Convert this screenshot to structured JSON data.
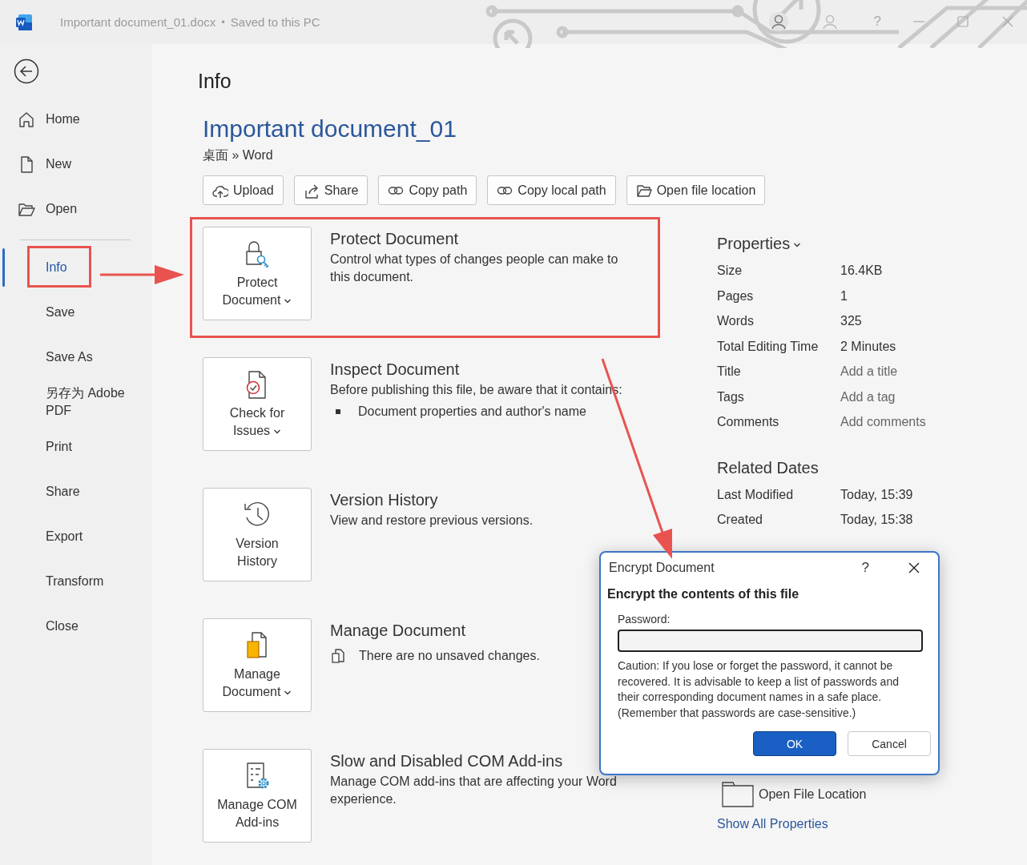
{
  "window": {
    "title": "Important document_01.docx",
    "separator": "•",
    "save_state": "Saved to this PC",
    "help": "?"
  },
  "nav_top": [
    {
      "kind": "home",
      "label": "Home",
      "selected": false,
      "highlighted": false
    },
    {
      "kind": "new",
      "label": "New",
      "selected": false,
      "highlighted": false
    },
    {
      "kind": "open",
      "label": "Open",
      "selected": false,
      "highlighted": false
    }
  ],
  "nav_bottom": [
    {
      "label": "Info",
      "selected": true,
      "highlighted": true
    },
    {
      "label": "Save",
      "selected": false,
      "highlighted": false
    },
    {
      "label": "Save As",
      "selected": false,
      "highlighted": false
    },
    {
      "label": "另存为 Adobe PDF",
      "selected": false,
      "highlighted": false
    },
    {
      "label": "Print",
      "selected": false,
      "highlighted": false
    },
    {
      "label": "Share",
      "selected": false,
      "highlighted": false
    },
    {
      "label": "Export",
      "selected": false,
      "highlighted": false
    },
    {
      "label": "Transform",
      "selected": false,
      "highlighted": false
    },
    {
      "label": "Close",
      "selected": false,
      "highlighted": false
    }
  ],
  "page_title": "Info",
  "document": {
    "name": "Important document_01",
    "path": "桌面 » Word"
  },
  "actions": [
    {
      "kind": "upload",
      "label": "Upload"
    },
    {
      "kind": "share",
      "label": "Share"
    },
    {
      "kind": "link",
      "label": "Copy path"
    },
    {
      "kind": "link",
      "label": "Copy local path"
    },
    {
      "kind": "folder",
      "label": "Open file location"
    }
  ],
  "sections": [
    {
      "kind": "protect",
      "button": "Protect Document",
      "dropdown": true,
      "title": "Protect Document",
      "description": "Control what types of changes people can make to this document.",
      "highlighted": true
    },
    {
      "kind": "inspect",
      "button": "Check for Issues",
      "dropdown": true,
      "title": "Inspect Document",
      "description": "Before publishing this file, be aware that it contains:",
      "bullets": [
        "Document properties and author's name"
      ],
      "highlighted": false
    },
    {
      "kind": "history",
      "button": "Version History",
      "dropdown": false,
      "title": "Version History",
      "description": "View and restore previous versions.",
      "highlighted": false
    },
    {
      "kind": "manage",
      "button": "Manage Document",
      "dropdown": true,
      "title": "Manage Document",
      "note": "There are no unsaved changes.",
      "highlighted": false
    },
    {
      "kind": "addins",
      "button": "Manage COM Add-ins",
      "dropdown": false,
      "title": "Slow and Disabled COM Add-ins",
      "description": "Manage COM add-ins that are affecting your Word experience.",
      "highlighted": false
    }
  ],
  "properties": {
    "heading": "Properties",
    "rows": [
      {
        "kind": "value",
        "label": "Size",
        "value": "16.4KB"
      },
      {
        "kind": "value",
        "label": "Pages",
        "value": "1"
      },
      {
        "kind": "value",
        "label": "Words",
        "value": "325"
      },
      {
        "kind": "value",
        "label": "Total Editing Time",
        "value": "2 Minutes"
      },
      {
        "kind": "editable",
        "label": "Title",
        "value": "Add a title"
      },
      {
        "kind": "editable",
        "label": "Tags",
        "value": "Add a tag"
      },
      {
        "kind": "editable",
        "label": "Comments",
        "value": "Add comments"
      }
    ]
  },
  "related_dates": {
    "heading": "Related Dates",
    "rows": [
      {
        "label": "Last Modified",
        "value": "Today, 15:39"
      },
      {
        "label": "Created",
        "value": "Today, 15:38"
      }
    ]
  },
  "open_file_location": "Open File Location",
  "show_all_properties": "Show All Properties",
  "dialog": {
    "title": "Encrypt Document",
    "help": "?",
    "heading": "Encrypt the contents of this file",
    "field_label": "Password:",
    "caution": "Caution: If you lose or forget the password, it cannot be recovered. It is advisable to keep a list of passwords and their corresponding document names in a safe place. (Remember that passwords are case-sensitive.)",
    "buttons": [
      {
        "label": "OK",
        "default": true
      },
      {
        "label": "Cancel",
        "default": false
      }
    ]
  }
}
